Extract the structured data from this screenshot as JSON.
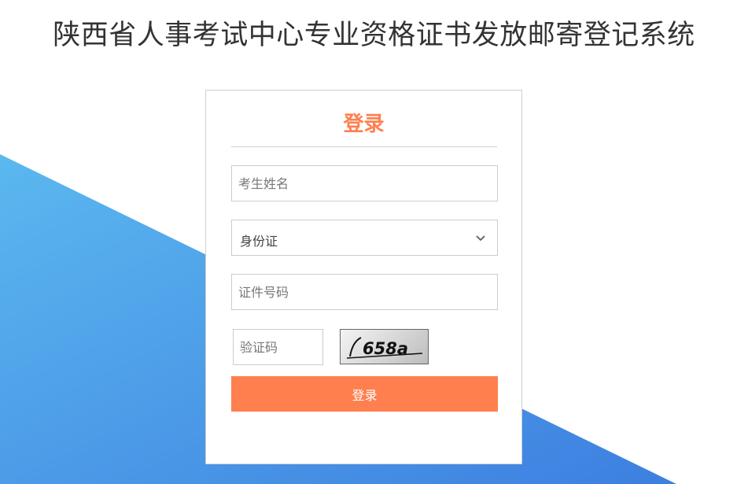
{
  "header": {
    "title": "陕西省人事考试中心专业资格证书发放邮寄登记系统"
  },
  "login": {
    "heading": "登录",
    "name_placeholder": "考生姓名",
    "id_type_selected": "身份证",
    "id_number_placeholder": "证件号码",
    "captcha_placeholder": "验证码",
    "captcha_text": "658a",
    "submit_label": "登录"
  },
  "colors": {
    "accent": "#ff7f4f",
    "background_blue_light": "#5bb8ef",
    "background_blue_dark": "#3d7fe0"
  }
}
